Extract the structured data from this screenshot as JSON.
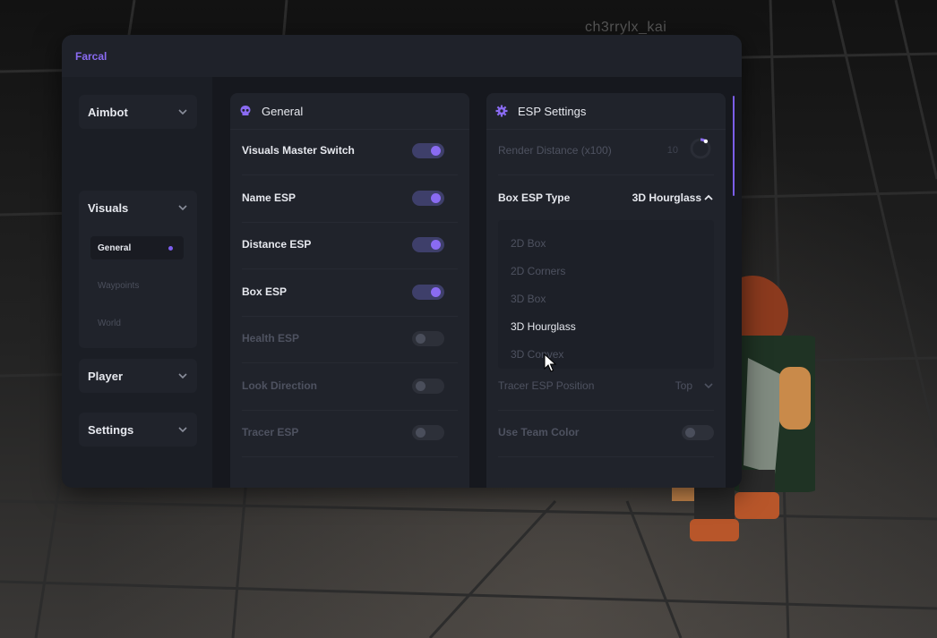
{
  "overlay": {
    "username": "ch3rrylx_kai"
  },
  "window": {
    "title": "Farcal"
  },
  "sidebar": {
    "items": [
      {
        "label": "Aimbot"
      },
      {
        "label": "Visuals",
        "expanded": true,
        "subitems": [
          {
            "label": "General",
            "active": true
          },
          {
            "label": "Waypoints",
            "active": false
          },
          {
            "label": "World",
            "active": false
          }
        ]
      },
      {
        "label": "Player"
      },
      {
        "label": "Settings"
      }
    ]
  },
  "general_panel": {
    "title": "General",
    "icon": "skull-icon",
    "rows": [
      {
        "label": "Visuals Master Switch",
        "enabled": true
      },
      {
        "label": "Name ESP",
        "enabled": true
      },
      {
        "label": "Distance ESP",
        "enabled": true
      },
      {
        "label": "Box ESP",
        "enabled": true
      },
      {
        "label": "Health ESP",
        "enabled": false
      },
      {
        "label": "Look Direction",
        "enabled": false
      },
      {
        "label": "Tracer ESP",
        "enabled": false
      }
    ]
  },
  "esp_panel": {
    "title": "ESP Settings",
    "icon": "gear-icon",
    "render_distance": {
      "label": "Render Distance (x100)",
      "value": "10",
      "fraction": 0.1
    },
    "box_type": {
      "label": "Box ESP Type",
      "value": "3D Hourglass",
      "options": [
        "2D Box",
        "2D Corners",
        "3D Box",
        "3D Hourglass",
        "3D Convex"
      ]
    },
    "tracer_position": {
      "label": "Tracer ESP Position",
      "value": "Top"
    },
    "team_color": {
      "label": "Use Team Color",
      "enabled": false
    }
  },
  "colors": {
    "accent": "#8a6bf2",
    "panel": "#20232b",
    "window": "#1c1f27"
  }
}
